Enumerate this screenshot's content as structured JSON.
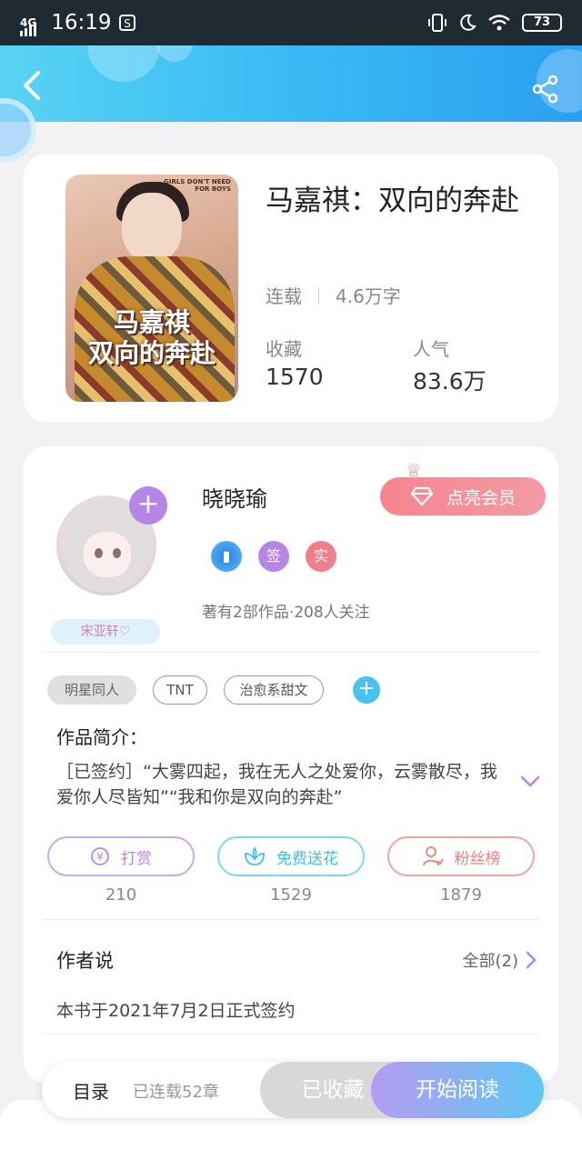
{
  "status_bar": {
    "network": "4G",
    "time": "16:19",
    "battery": "73",
    "icons": [
      "network-icon",
      "signal-icon",
      "notification-icon",
      "vibrate-icon",
      "moon-icon",
      "wifi-icon",
      "battery-icon"
    ]
  },
  "header": {
    "back_icon": "back-arrow-icon",
    "share_icon": "share-icon",
    "gradient": [
      "#5ad3f3",
      "#2b9ff0"
    ]
  },
  "book": {
    "title": "马嘉祺：双向的奔赴",
    "cover_title": "马嘉祺\n双向的奔赴",
    "cover_small_text": "GIRLS DON'T NEED FOR BOYS",
    "status": "连载",
    "word_count": "4.6万字",
    "stats": [
      {
        "label": "收藏",
        "value": "1570"
      },
      {
        "label": "人气",
        "value": "83.6万"
      }
    ]
  },
  "author": {
    "name": "晓晓瑜",
    "vip_button": "点亮会员",
    "badges": [
      {
        "icon": "level-badge-icon",
        "text": "",
        "color": "#3b8fe8"
      },
      {
        "icon": "signed-badge-icon",
        "text": "签",
        "color": "#b585e8"
      },
      {
        "icon": "verified-badge-icon",
        "text": "实",
        "color": "#f07f8b"
      }
    ],
    "stats": "著有2部作品·208人关注",
    "fan_badge": "宋亚轩♡"
  },
  "tags": [
    "明星同人",
    "TNT",
    "治愈系甜文"
  ],
  "intro": {
    "title": "作品简介：",
    "text": "［已签约］“大雾四起，我在无人之处爱你，云雾散尽，我爱你人尽皆知”“我和你是双向的奔赴”"
  },
  "actions": [
    {
      "label": "打赏",
      "count": "210",
      "icon": "yen-icon",
      "color": "#b585e8"
    },
    {
      "label": "免费送花",
      "count": "1529",
      "icon": "flower-icon",
      "color": "#3ec0e8"
    },
    {
      "label": "粉丝榜",
      "count": "1879",
      "icon": "user-icon",
      "color": "#f07f7f"
    }
  ],
  "author_says": {
    "title": "作者说",
    "all_label": "全部(2)",
    "text": "本书于2021年7月2日正式签约"
  },
  "bottom_bar": {
    "toc_label": "目录",
    "toc_sub": "已连载52章",
    "collected_label": "已收藏",
    "read_label": "开始阅读"
  }
}
